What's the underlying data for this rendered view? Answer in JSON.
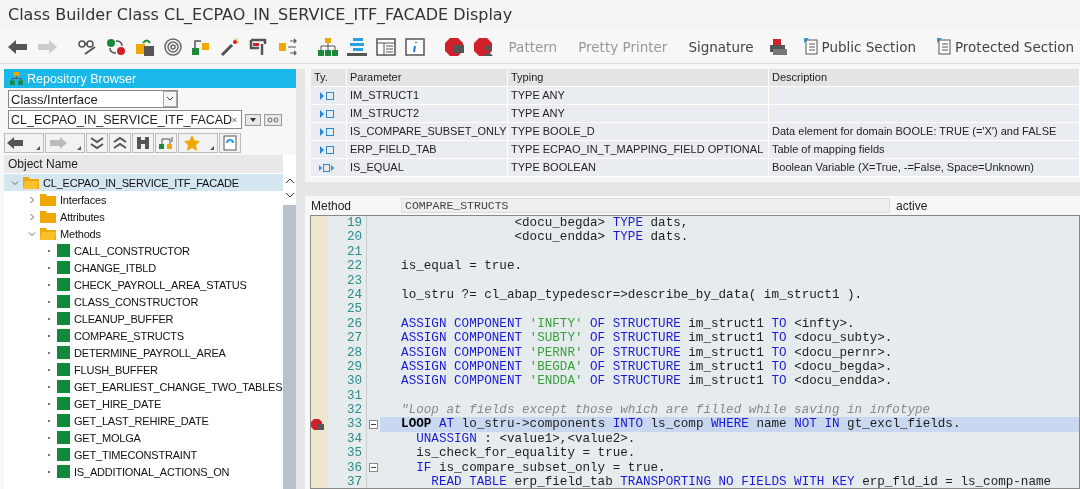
{
  "window": {
    "title": "Class Builder Class CL_ECPAO_IN_SERVICE_ITF_FACADE Display"
  },
  "toolbar": {
    "nav_buttons": [
      {
        "kind": "back",
        "disabled": false
      },
      {
        "kind": "forward",
        "disabled": true
      }
    ],
    "text_buttons": [
      {
        "label": "Pattern",
        "disabled": true
      },
      {
        "label": "Pretty Printer",
        "disabled": true
      },
      {
        "label": "Signature",
        "disabled": false
      }
    ],
    "section_buttons": [
      {
        "label": "Public Section"
      },
      {
        "label": "Protected Section"
      }
    ]
  },
  "repository_browser": {
    "title": "Repository Browser",
    "object_type": "Class/Interface",
    "object_name": "CL_ECPAO_IN_SERVICE_ITF_FACAD",
    "column": "Object Name",
    "tree": [
      {
        "kind": "class",
        "label": "CL_ECPAO_IN_SERVICE_ITF_FACADE",
        "selected": true,
        "expanded": true,
        "children": [
          {
            "kind": "folder",
            "label": "Interfaces",
            "selected": false,
            "expanded": false
          },
          {
            "kind": "folder",
            "label": "Attributes",
            "selected": false,
            "expanded": false
          },
          {
            "kind": "folder",
            "label": "Methods",
            "selected": false,
            "expanded": true,
            "children": [
              {
                "kind": "method",
                "label": "CALL_CONSTRUCTOR",
                "selected": false
              },
              {
                "kind": "method",
                "label": "CHANGE_ITBLD",
                "selected": false
              },
              {
                "kind": "method",
                "label": "CHECK_PAYROLL_AREA_STATUS",
                "selected": false
              },
              {
                "kind": "method",
                "label": "CLASS_CONSTRUCTOR",
                "selected": false
              },
              {
                "kind": "method",
                "label": "CLEANUP_BUFFER",
                "selected": false
              },
              {
                "kind": "method",
                "label": "COMPARE_STRUCTS",
                "selected": false
              },
              {
                "kind": "method",
                "label": "DETERMINE_PAYROLL_AREA",
                "selected": false
              },
              {
                "kind": "method",
                "label": "FLUSH_BUFFER",
                "selected": false
              },
              {
                "kind": "method",
                "label": "GET_EARLIEST_CHANGE_TWO_TABLES",
                "selected": false
              },
              {
                "kind": "method",
                "label": "GET_HIRE_DATE",
                "selected": false
              },
              {
                "kind": "method",
                "label": "GET_LAST_REHIRE_DATE",
                "selected": false
              },
              {
                "kind": "method",
                "label": "GET_MOLGA",
                "selected": false
              },
              {
                "kind": "method",
                "label": "GET_TIMECONSTRAINT",
                "selected": false
              },
              {
                "kind": "method",
                "label": "IS_ADDITIONAL_ACTIONS_ON",
                "selected": false
              }
            ]
          }
        ]
      }
    ]
  },
  "parameters": {
    "columns": [
      "Ty.",
      "Parameter",
      "Typing",
      "Description"
    ],
    "rows": [
      {
        "kind": "importing",
        "parameter": "IM_STRUCT1",
        "typing": "TYPE ANY"
      },
      {
        "kind": "importing",
        "parameter": "IM_STRUCT2",
        "typing": "TYPE ANY"
      },
      {
        "kind": "importing",
        "parameter": "IS_COMPARE_SUBSET_ONLY",
        "typing": "TYPE BOOLE_D",
        "description": "Data element for domain BOOLE: TRUE (='X') and FALSE"
      },
      {
        "kind": "importing",
        "parameter": "ERP_FIELD_TAB",
        "typing": "TYPE ECPAO_IN_T_MAPPING_FIELD OPTIONAL",
        "description": "Table of mapping fields"
      },
      {
        "kind": "returning",
        "parameter": "IS_EQUAL",
        "typing": "TYPE BOOLEAN",
        "description": "Boolean Variable (X=True, -=False, Space=Unknown)"
      }
    ]
  },
  "editor": {
    "label": "Method",
    "method": "COMPARE_STRUCTS",
    "status": "active",
    "lines": [
      {
        "number": "19",
        "current": false,
        "breakpoint": false,
        "fold": false,
        "tokens": [
          {
            "kind": "text",
            "text": "                 <docu_begda> "
          },
          {
            "kind": "keyword",
            "text": "TYPE"
          },
          {
            "kind": "text",
            "text": " dats,"
          }
        ]
      },
      {
        "number": "20",
        "current": false,
        "breakpoint": false,
        "fold": false,
        "tokens": [
          {
            "kind": "text",
            "text": "                 <docu_endda> "
          },
          {
            "kind": "keyword",
            "text": "TYPE"
          },
          {
            "kind": "text",
            "text": " dats."
          }
        ]
      },
      {
        "number": "21",
        "current": false,
        "breakpoint": false,
        "fold": false
      },
      {
        "number": "22",
        "current": false,
        "breakpoint": false,
        "fold": false,
        "tokens": [
          {
            "kind": "text",
            "text": "  is_equal = true."
          }
        ]
      },
      {
        "number": "23",
        "current": false,
        "breakpoint": false,
        "fold": false
      },
      {
        "number": "24",
        "current": false,
        "breakpoint": false,
        "fold": false,
        "tokens": [
          {
            "kind": "text",
            "text": "  lo_stru ?= cl_abap_typedescr=>describe_by_data( im_struct1 )."
          }
        ]
      },
      {
        "number": "25",
        "current": false,
        "breakpoint": false,
        "fold": false
      },
      {
        "number": "26",
        "current": false,
        "breakpoint": false,
        "fold": false,
        "tokens": [
          {
            "kind": "keyword",
            "text": "  ASSIGN COMPONENT "
          },
          {
            "kind": "string",
            "text": "'INFTY'"
          },
          {
            "kind": "keyword",
            "text": " OF STRUCTURE"
          },
          {
            "kind": "text",
            "text": " im_struct1 "
          },
          {
            "kind": "keyword",
            "text": "TO"
          },
          {
            "kind": "text",
            "text": " <infty>."
          }
        ]
      },
      {
        "number": "27",
        "current": false,
        "breakpoint": false,
        "fold": false,
        "tokens": [
          {
            "kind": "keyword",
            "text": "  ASSIGN COMPONENT "
          },
          {
            "kind": "string",
            "text": "'SUBTY'"
          },
          {
            "kind": "keyword",
            "text": " OF STRUCTURE"
          },
          {
            "kind": "text",
            "text": " im_struct1 "
          },
          {
            "kind": "keyword",
            "text": "TO"
          },
          {
            "kind": "text",
            "text": " <docu_subty>."
          }
        ]
      },
      {
        "number": "28",
        "current": false,
        "breakpoint": false,
        "fold": false,
        "tokens": [
          {
            "kind": "keyword",
            "text": "  ASSIGN COMPONENT "
          },
          {
            "kind": "string",
            "text": "'PERNR'"
          },
          {
            "kind": "keyword",
            "text": " OF STRUCTURE"
          },
          {
            "kind": "text",
            "text": " im_struct1 "
          },
          {
            "kind": "keyword",
            "text": "TO"
          },
          {
            "kind": "text",
            "text": " <docu_pernr>."
          }
        ]
      },
      {
        "number": "29",
        "current": false,
        "breakpoint": false,
        "fold": false,
        "tokens": [
          {
            "kind": "keyword",
            "text": "  ASSIGN COMPONENT "
          },
          {
            "kind": "string",
            "text": "'BEGDA'"
          },
          {
            "kind": "keyword",
            "text": " OF STRUCTURE"
          },
          {
            "kind": "text",
            "text": " im_struct1 "
          },
          {
            "kind": "keyword",
            "text": "TO"
          },
          {
            "kind": "text",
            "text": " <docu_begda>."
          }
        ]
      },
      {
        "number": "30",
        "current": false,
        "breakpoint": false,
        "fold": false,
        "tokens": [
          {
            "kind": "keyword",
            "text": "  ASSIGN COMPONENT "
          },
          {
            "kind": "string",
            "text": "'ENDDA'"
          },
          {
            "kind": "keyword",
            "text": " OF STRUCTURE"
          },
          {
            "kind": "text",
            "text": " im_struct1 "
          },
          {
            "kind": "keyword",
            "text": "TO"
          },
          {
            "kind": "text",
            "text": " <docu_endda>."
          }
        ]
      },
      {
        "number": "31",
        "current": false,
        "breakpoint": false,
        "fold": false
      },
      {
        "number": "32",
        "current": false,
        "breakpoint": false,
        "fold": false,
        "tokens": [
          {
            "kind": "comment",
            "text": "  \"Loop at fields except those which are filled while saving in infotype"
          }
        ]
      },
      {
        "number": "33",
        "current": true,
        "breakpoint": true,
        "fold": true,
        "tokens": [
          {
            "kind": "bold",
            "text": "  LOOP"
          },
          {
            "kind": "keyword",
            "text": " AT"
          },
          {
            "kind": "text",
            "text": " lo_stru->components "
          },
          {
            "kind": "keyword",
            "text": "INTO"
          },
          {
            "kind": "text",
            "text": " ls_comp "
          },
          {
            "kind": "keyword",
            "text": "WHERE"
          },
          {
            "kind": "text",
            "text": " name "
          },
          {
            "kind": "keyword",
            "text": "NOT IN"
          },
          {
            "kind": "text",
            "text": " gt_excl_fields."
          }
        ]
      },
      {
        "number": "34",
        "current": false,
        "breakpoint": false,
        "fold": false,
        "tokens": [
          {
            "kind": "keyword",
            "text": "    UNASSIGN"
          },
          {
            "kind": "text",
            "text": " : <value1>,<value2>."
          }
        ]
      },
      {
        "number": "35",
        "current": false,
        "breakpoint": false,
        "fold": false,
        "tokens": [
          {
            "kind": "text",
            "text": "    is_check_for_equality = true."
          }
        ]
      },
      {
        "number": "36",
        "current": false,
        "breakpoint": false,
        "fold": true,
        "tokens": [
          {
            "kind": "keyword",
            "text": "    IF"
          },
          {
            "kind": "text",
            "text": " is_compare_subset_only = true."
          }
        ]
      },
      {
        "number": "37",
        "current": false,
        "breakpoint": false,
        "fold": false,
        "tokens": [
          {
            "kind": "keyword",
            "text": "      READ TABLE"
          },
          {
            "kind": "text",
            "text": " erp_field_tab "
          },
          {
            "kind": "keyword",
            "text": "TRANSPORTING NO FIELDS WITH KEY"
          },
          {
            "kind": "text",
            "text": " erp_fld_id = ls_comp-name"
          }
        ]
      }
    ]
  }
}
